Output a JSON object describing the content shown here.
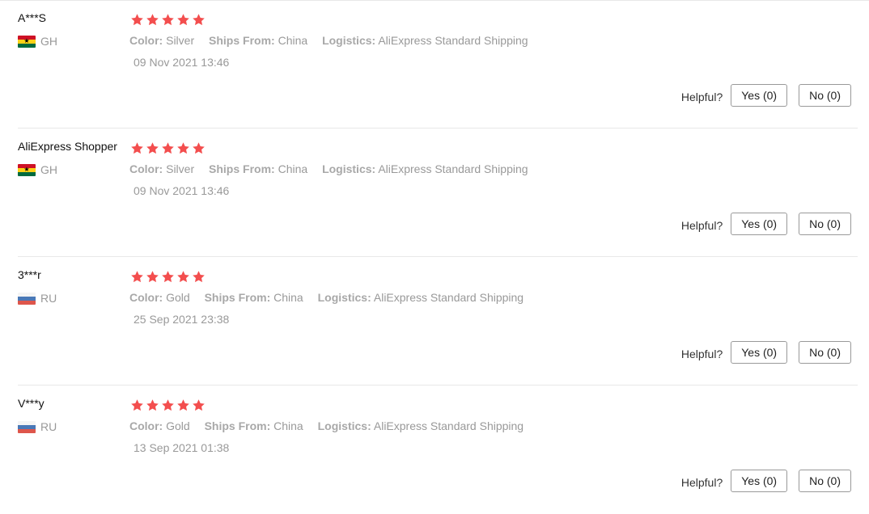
{
  "colors": {
    "star": "#f34e4e",
    "muted_text": "#999999",
    "divider": "#e8e8e8"
  },
  "labels": {
    "color": "Color:",
    "ships_from": "Ships From:",
    "logistics": "Logistics:",
    "helpful": "Helpful?"
  },
  "reviews": [
    {
      "user": "A***S",
      "country": "GH",
      "flag": "ghana-flag-icon",
      "rating": 5,
      "color": "Silver",
      "ships_from": "China",
      "logistics": "AliExpress Standard Shipping",
      "date": "09 Nov 2021 13:46",
      "yes": "Yes (0)",
      "no": "No (0)"
    },
    {
      "user": "AliExpress Shopper",
      "country": "GH",
      "flag": "ghana-flag-icon",
      "rating": 5,
      "color": "Silver",
      "ships_from": "China",
      "logistics": "AliExpress Standard Shipping",
      "date": "09 Nov 2021 13:46",
      "yes": "Yes (0)",
      "no": "No (0)"
    },
    {
      "user": "3***r",
      "country": "RU",
      "flag": "russia-flag-icon",
      "rating": 5,
      "color": "Gold",
      "ships_from": "China",
      "logistics": "AliExpress Standard Shipping",
      "date": "25 Sep 2021 23:38",
      "yes": "Yes (0)",
      "no": "No (0)"
    },
    {
      "user": "V***y",
      "country": "RU",
      "flag": "russia-flag-icon",
      "rating": 5,
      "color": "Gold",
      "ships_from": "China",
      "logistics": "AliExpress Standard Shipping",
      "date": "13 Sep 2021 01:38",
      "yes": "Yes (0)",
      "no": "No (0)"
    }
  ]
}
